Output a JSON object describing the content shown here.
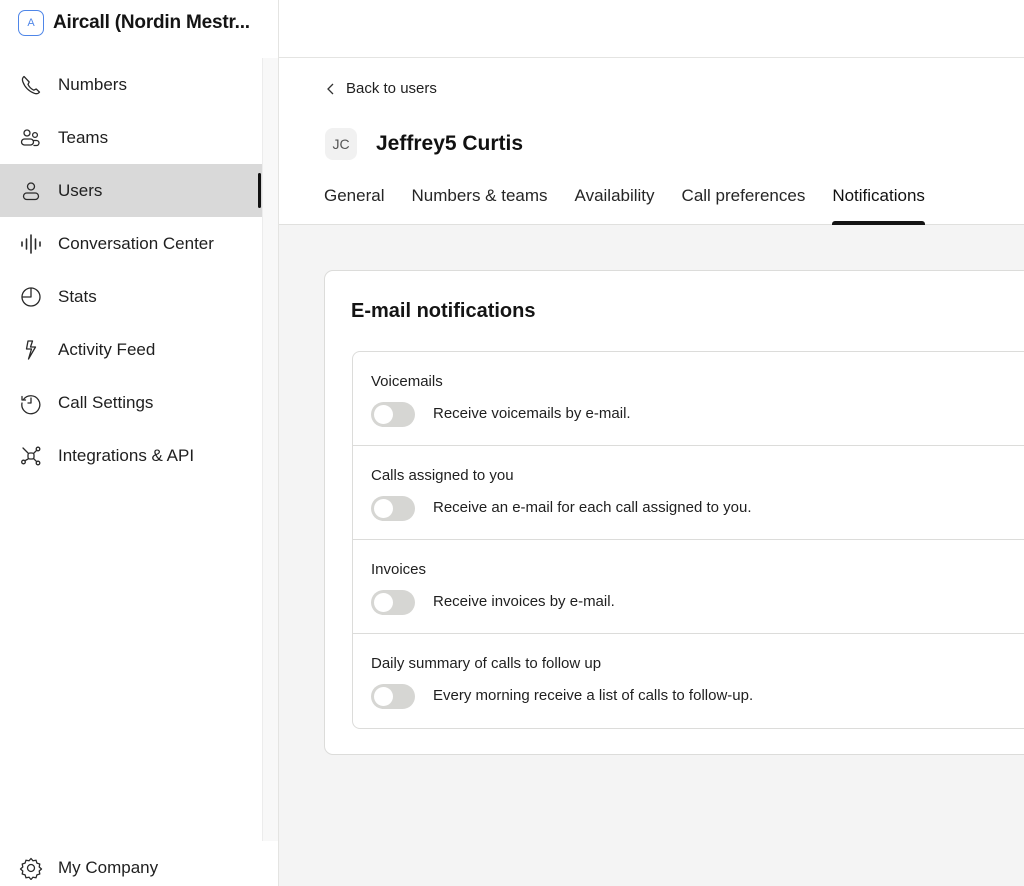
{
  "brand": {
    "badge": "A",
    "name": "Aircall (Nordin Mestr...",
    "accent": "#4f86e8"
  },
  "sidebar": {
    "items": [
      {
        "label": "Numbers",
        "icon": "phone-icon",
        "active": false
      },
      {
        "label": "Teams",
        "icon": "teams-icon",
        "active": false
      },
      {
        "label": "Users",
        "icon": "user-icon",
        "active": true
      },
      {
        "label": "Conversation Center",
        "icon": "soundwave-icon",
        "active": false
      },
      {
        "label": "Stats",
        "icon": "pie-chart-icon",
        "active": false
      },
      {
        "label": "Activity Feed",
        "icon": "lightning-icon",
        "active": false
      },
      {
        "label": "Call Settings",
        "icon": "history-icon",
        "active": false
      },
      {
        "label": "Integrations & API",
        "icon": "network-icon",
        "active": false
      }
    ],
    "bottom": {
      "label": "My Company",
      "icon": "gear-icon"
    }
  },
  "header": {
    "back_label": "Back to users",
    "avatar_initials": "JC",
    "user_name": "Jeffrey5 Curtis",
    "tabs": [
      {
        "label": "General",
        "active": false
      },
      {
        "label": "Numbers & teams",
        "active": false
      },
      {
        "label": "Availability",
        "active": false
      },
      {
        "label": "Call preferences",
        "active": false
      },
      {
        "label": "Notifications",
        "active": true
      }
    ]
  },
  "notifications": {
    "title": "E-mail notifications",
    "items": [
      {
        "title": "Voicemails",
        "description": "Receive voicemails by e-mail.",
        "enabled": false
      },
      {
        "title": "Calls assigned to you",
        "description": "Receive an e-mail for each call assigned to you.",
        "enabled": false
      },
      {
        "title": "Invoices",
        "description": "Receive invoices by e-mail.",
        "enabled": false
      },
      {
        "title": "Daily summary of calls to follow up",
        "description": "Every morning receive a list of calls to follow-up.",
        "enabled": false
      }
    ]
  }
}
